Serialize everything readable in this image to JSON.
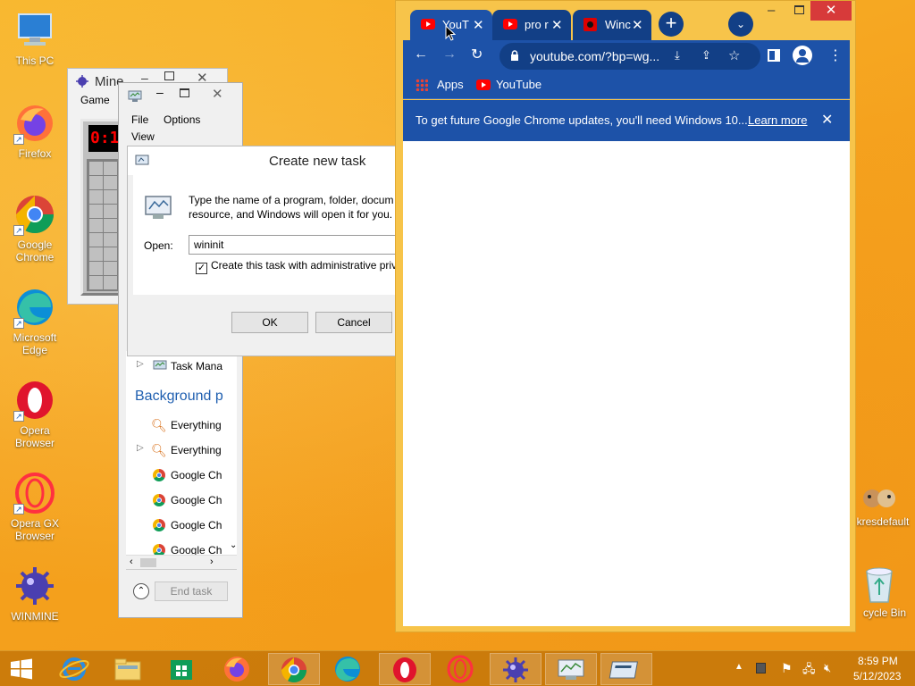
{
  "desktop": {
    "icons": [
      {
        "label": "This PC"
      },
      {
        "label": "Firefox"
      },
      {
        "label": "Google Chrome"
      },
      {
        "label": "Microsoft Edge"
      },
      {
        "label": "Opera Browser"
      },
      {
        "label": "Opera GX Browser"
      },
      {
        "label": "WINMINE"
      },
      {
        "label": "kresdefault"
      },
      {
        "label": "cycle Bin"
      }
    ]
  },
  "minesweeper": {
    "title": "Mine",
    "menu_game": "Game",
    "counter": "0:1"
  },
  "taskmanager": {
    "menu_file": "File",
    "menu_options": "Options",
    "menu_view": "View",
    "rows": [
      {
        "label": "Task Mana"
      },
      {
        "label": "Everything"
      },
      {
        "label": "Everything"
      },
      {
        "label": "Google Ch"
      },
      {
        "label": "Google Ch"
      },
      {
        "label": "Google Ch"
      },
      {
        "label": "Google Ch"
      }
    ],
    "bg_heading": "Background p",
    "end_task": "End task"
  },
  "run_dialog": {
    "title": "Create new task",
    "desc_line1": "Type the name of a program, folder, docum",
    "desc_line2": "resource, and Windows will open it for you.",
    "open_label": "Open:",
    "open_value": "wininit",
    "admin_label": "Create this task with administrative priv",
    "ok": "OK",
    "cancel": "Cancel"
  },
  "chrome": {
    "tabs": [
      {
        "label": "YouT"
      },
      {
        "label": "pro r"
      },
      {
        "label": "Winc"
      }
    ],
    "url": "youtube.com/?bp=wg...",
    "bookmarks": [
      {
        "label": "Apps"
      },
      {
        "label": "YouTube"
      }
    ],
    "info_text": "To get future Google Chrome updates, you'll need Windows 10...",
    "info_link": "Learn more"
  },
  "taskbar": {
    "time": "8:59 PM",
    "date": "5/12/2023"
  },
  "colors": {
    "chrome_frame": "#1d52a8",
    "chrome_tab_active": "#1d52a8",
    "desktop_bg": "#f5a623"
  }
}
